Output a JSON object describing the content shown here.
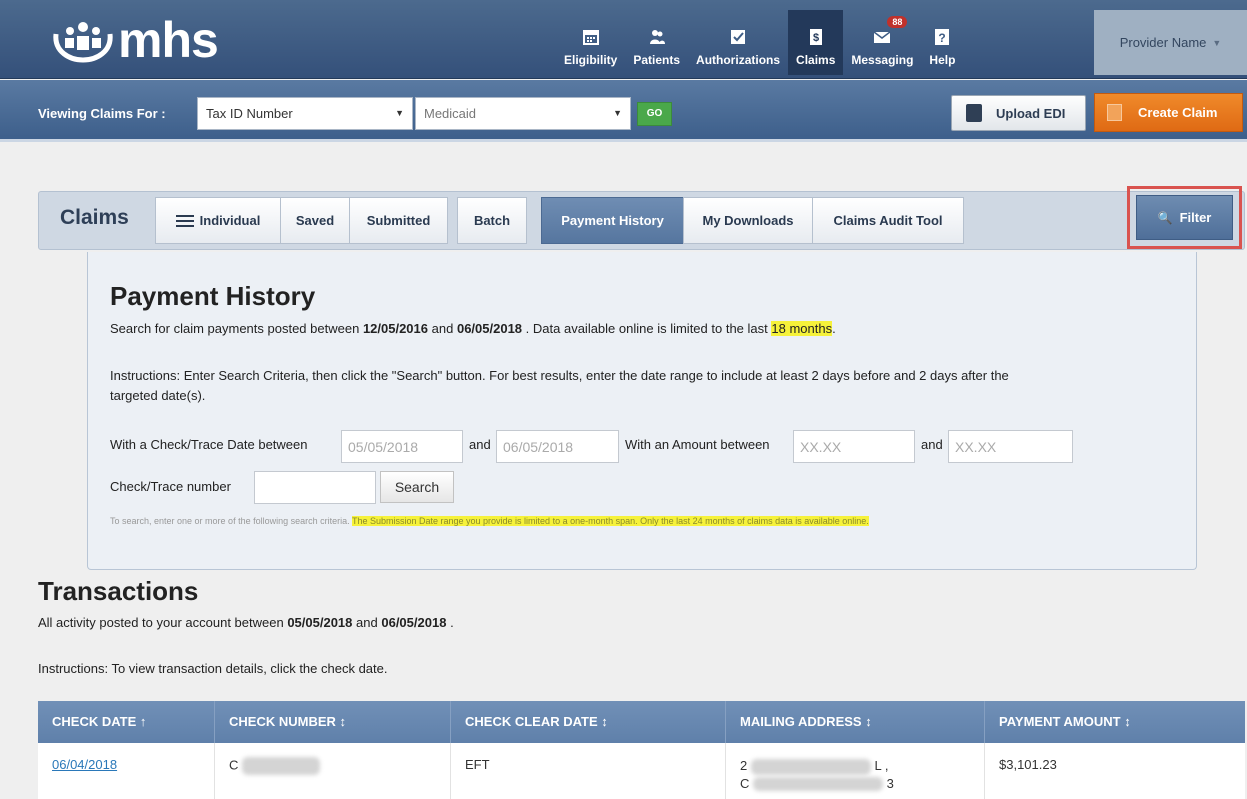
{
  "brand": {
    "logo_text": "mhs"
  },
  "nav": {
    "items": [
      {
        "label": "Eligibility",
        "icon": "calendar-icon"
      },
      {
        "label": "Patients",
        "icon": "patients-icon"
      },
      {
        "label": "Authorizations",
        "icon": "checkbox-icon"
      },
      {
        "label": "Claims",
        "icon": "dollar-document-icon",
        "active": true
      },
      {
        "label": "Messaging",
        "icon": "envelope-icon",
        "badge": "88"
      },
      {
        "label": "Help",
        "icon": "question-icon"
      }
    ],
    "provider": "Provider Name"
  },
  "subbar": {
    "viewing_label": "Viewing Claims For :",
    "tax_id_select": "Tax ID Number",
    "plan_select": "Medicaid",
    "go": "GO",
    "upload_edi": "Upload EDI",
    "create_claim": "Create Claim"
  },
  "claims_bar": {
    "title": "Claims",
    "tabs": [
      "Individual",
      "Saved",
      "Submitted",
      "Batch",
      "Payment History",
      "My Downloads",
      "Claims Audit Tool"
    ],
    "active_tab": "Payment History",
    "filter": "Filter"
  },
  "payment_history": {
    "title": "Payment History",
    "line1_pre": "Search for claim payments posted between",
    "date_from": "12/05/2016",
    "line1_and": "and",
    "date_to": "06/05/2018",
    "line1_post": ". Data available online is limited to the last",
    "limit": "18 months",
    "line1_end": ".",
    "instructions_1": "Instructions: Enter Search Criteria, then click the \"Search\" button. For best results, enter the date range to include at least 2 days before and 2 days after the",
    "instructions_2": "targeted date(s).",
    "check_date_label": "With a Check/Trace Date between",
    "check_date_from": "05/05/2018",
    "and_label": "and",
    "check_date_to": "06/05/2018",
    "amount_label": "With an Amount between",
    "amount_placeholder": "XX.XX",
    "check_number_label": "Check/Trace number",
    "check_number_value": "",
    "search": "Search",
    "note_plain": "To search, enter one or more of the following search criteria.",
    "note_highlight": "The Submission Date range you provide is limited to a one-month span. Only the last 24 months of claims data is available online."
  },
  "transactions": {
    "title": "Transactions",
    "line_pre": "All activity posted to your account between",
    "from": "05/05/2018",
    "and": "and",
    "to": "06/05/2018",
    "line_end": ".",
    "instructions": "Instructions: To view transaction details, click the check date.",
    "columns": [
      "CHECK DATE ↑",
      "CHECK NUMBER ↕",
      "CHECK CLEAR DATE ↕",
      "MAILING ADDRESS ↕",
      "PAYMENT AMOUNT ↕"
    ],
    "rows": [
      {
        "check_date": "06/04/2018",
        "check_number": "C",
        "clear_date": "EFT",
        "address_line1_start": "2",
        "address_line1_end": "L ,",
        "address_line2_start": "C",
        "address_line2_end": "3",
        "amount": "$3,101.23"
      }
    ]
  },
  "colors": {
    "nav_bg": "#3f5d85",
    "accent_orange": "#e8761c",
    "go_green": "#4aa84a",
    "highlight": "#f6f23a",
    "filter_outline": "#d9534f"
  }
}
